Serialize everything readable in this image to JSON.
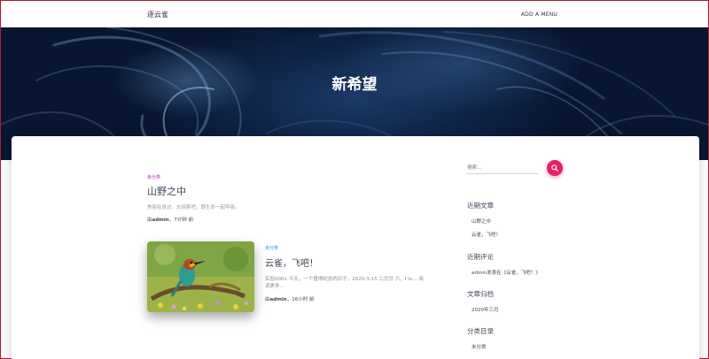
{
  "site": {
    "brand": "逐云雀",
    "menu_label": "ADD A MENU"
  },
  "hero": {
    "title": "新希望"
  },
  "posts": [
    {
      "category": "未分类",
      "title": "山野之中",
      "excerpt": "美丽在身边，去探索吧，跟生命一起呼吸。",
      "meta_prefix": "由",
      "author": "admin",
      "meta_suffix": "，7分钟 前"
    },
    {
      "category": "未分类",
      "title": "云雀，飞吧！",
      "excerpt": "实验0001 今天，一个值得纪念的日子，2020-3-15 二月廿 六，I lo… 阅读更多…",
      "meta_prefix": "由",
      "author": "admin",
      "meta_suffix": "，16小时 前"
    }
  ],
  "sidebar": {
    "search_placeholder": "搜索…",
    "recent_posts_title": "近期文章",
    "recent_posts": [
      "山野之中",
      "云雀，飞吧！"
    ],
    "recent_comments_title": "近期评论",
    "recent_comment": "admin发表在《云雀，飞吧！》",
    "archives_title": "文章归档",
    "archives": [
      "2020年三月"
    ],
    "categories_title": "分类目录",
    "categories": [
      "未分类"
    ]
  },
  "colors": {
    "accent": "#e91e63",
    "category_purple": "#9c27b0",
    "category_cyan": "#00acc1",
    "hero_dark": "#0e2446"
  },
  "icons": {
    "search": "search-icon"
  }
}
